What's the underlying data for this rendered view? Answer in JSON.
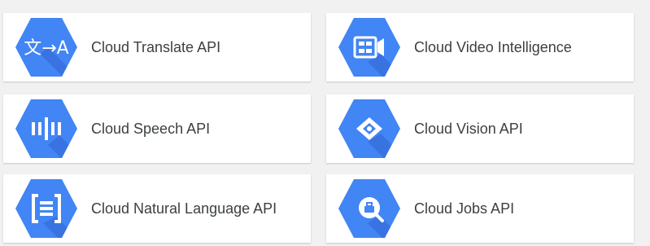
{
  "accent_color": "#4285f4",
  "shadow_color": "#3367d6",
  "cards": [
    {
      "label": "Cloud Translate API",
      "icon": "translate-icon"
    },
    {
      "label": "Cloud Video Intelligence",
      "icon": "video-intelligence-icon"
    },
    {
      "label": "Cloud Speech API",
      "icon": "speech-icon"
    },
    {
      "label": "Cloud Vision API",
      "icon": "vision-icon"
    },
    {
      "label": "Cloud Natural Language API",
      "icon": "natural-language-icon"
    },
    {
      "label": "Cloud Jobs API",
      "icon": "jobs-icon"
    }
  ],
  "icon_text": {
    "translate": "文→A"
  }
}
